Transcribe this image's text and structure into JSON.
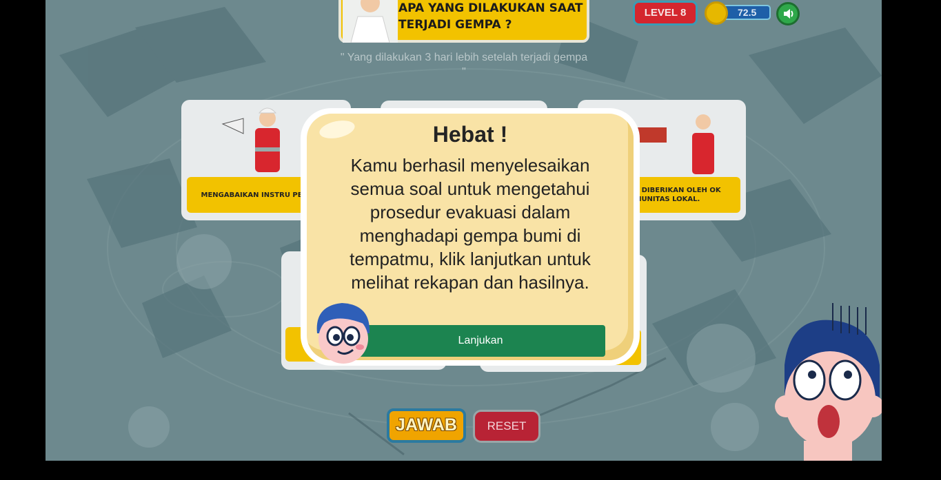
{
  "header": {
    "question": "APA YANG DILAKUKAN SAAT TERJADI GEMPA ?",
    "subtitle": "\" Yang dilakukan 3 hari lebih setelah terjadi gempa \""
  },
  "hud": {
    "level_label": "LEVEL 8",
    "score": "72.5",
    "coin_icon": "coin-icon",
    "sound_icon": "speaker-icon"
  },
  "cards": [
    {
      "label": "MENGABAIKAN INSTRU PETUGAS."
    },
    {
      "label": "KSI YANG DIBERIKAN OLEH OK KOMUNITAS LOKAL."
    }
  ],
  "buttons": {
    "jawab": "JAWAB",
    "reset": "RESET"
  },
  "modal": {
    "title": "Hebat !",
    "message": "Kamu berhasil menyelesaikan semua soal untuk mengetahui prosedur evakuasi dalam menghadapi gempa bumi di tempatmu, klik lanjutkan untuk melihat rekapan dan hasilnya.",
    "button": "Lanjukan"
  },
  "colors": {
    "accent_yellow": "#f2c200",
    "modal_bg": "#f9e3a6",
    "continue_green": "#1c8450",
    "level_red": "#d4262e",
    "reset_red": "#b82335",
    "scene_bg": "#6f8b90"
  }
}
